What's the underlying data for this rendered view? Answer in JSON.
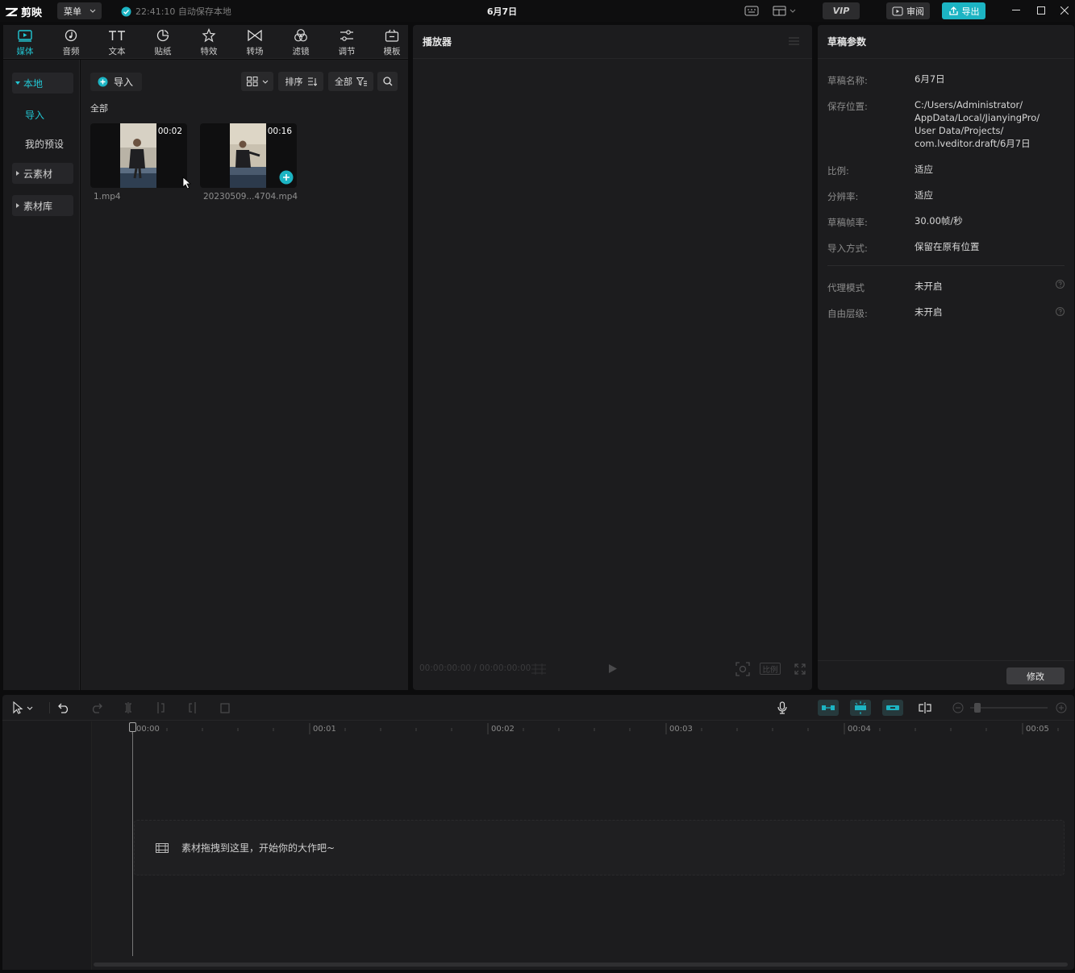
{
  "app": {
    "name": "剪映",
    "menu_label": "菜单",
    "autosave_text": "22:41:10 自动保存本地",
    "doc_title": "6月7日",
    "vip_label": "VIP",
    "review_label": "审阅",
    "export_label": "导出"
  },
  "media_tabs": [
    {
      "label": "媒体",
      "icon": "media-icon",
      "active": true
    },
    {
      "label": "音频",
      "icon": "audio-icon"
    },
    {
      "label": "文本",
      "icon": "text-icon"
    },
    {
      "label": "贴纸",
      "icon": "sticker-icon"
    },
    {
      "label": "特效",
      "icon": "effects-icon"
    },
    {
      "label": "转场",
      "icon": "transition-icon"
    },
    {
      "label": "滤镜",
      "icon": "filter-icon"
    },
    {
      "label": "调节",
      "icon": "adjust-icon"
    },
    {
      "label": "模板",
      "icon": "template-icon"
    }
  ],
  "left_nav": {
    "local": "本地",
    "import": "导入",
    "my_presets": "我的预设",
    "cloud": "云素材",
    "library": "素材库"
  },
  "media": {
    "import_label": "导入",
    "sort_label": "排序",
    "filter_label": "全部",
    "section_label": "全部",
    "items": [
      {
        "name": "1.mp4",
        "duration": "00:02"
      },
      {
        "name": "20230509...4704.mp4",
        "duration": "00:16"
      }
    ]
  },
  "player": {
    "title": "播放器",
    "timecode": "00:00:00:00 / 00:00:00:00",
    "ratio_label": "比例"
  },
  "params": {
    "title": "草稿参数",
    "rows": [
      {
        "label": "草稿名称:",
        "value": "6月7日"
      },
      {
        "label": "保存位置:",
        "value_lines": [
          "C:/Users/Administrator/",
          "AppData/Local/JianyingPro/",
          "User Data/Projects/",
          "com.lveditor.draft/6月7日"
        ]
      },
      {
        "label": "比例:",
        "value": "适应"
      },
      {
        "label": "分辨率:",
        "value": "适应"
      },
      {
        "label": "草稿帧率:",
        "value": "30.00帧/秒"
      },
      {
        "label": "导入方式:",
        "value": "保留在原有位置"
      }
    ],
    "proxy_label": "代理模式",
    "proxy_value": "未开启",
    "layer_label": "自由层级:",
    "layer_value": "未开启",
    "modify_label": "修改"
  },
  "timeline": {
    "ticks": [
      "00:00",
      "00:01",
      "00:02",
      "00:03",
      "00:04",
      "00:05"
    ],
    "drop_hint": "素材拖拽到这里，开始你的大作吧~"
  },
  "colors": {
    "accent": "#1cb4c3",
    "bg": "#1c1c1e"
  }
}
